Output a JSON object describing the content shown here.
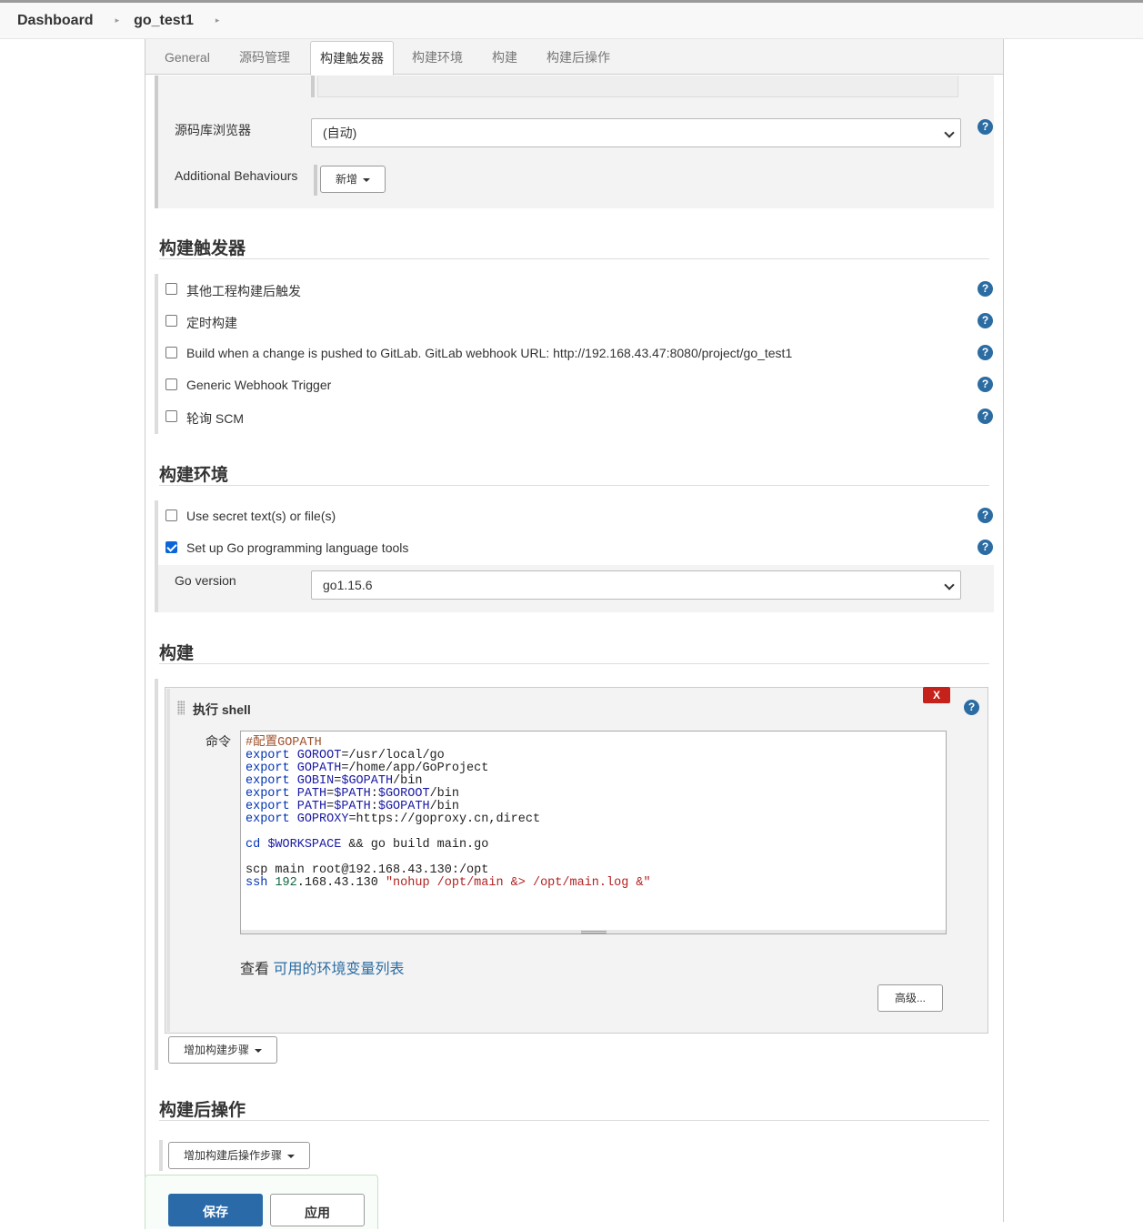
{
  "breadcrumbs": {
    "home": "Dashboard",
    "project": "go_test1"
  },
  "tabs": [
    {
      "label": "General"
    },
    {
      "label": "源码管理"
    },
    {
      "label": "构建触发器"
    },
    {
      "label": "构建环境"
    },
    {
      "label": "构建"
    },
    {
      "label": "构建后操作"
    }
  ],
  "scm": {
    "repo_browser_label": "源码库浏览器",
    "repo_browser_value": "(自动)",
    "additional_behaviours_label": "Additional Behaviours",
    "add_button": "新增"
  },
  "triggers": {
    "title": "构建触发器",
    "items": [
      {
        "label": "其他工程构建后触发",
        "checked": false
      },
      {
        "label": "定时构建",
        "checked": false
      },
      {
        "label": "Build when a change is pushed to GitLab. GitLab webhook URL: http://192.168.43.47:8080/project/go_test1",
        "checked": false
      },
      {
        "label": "Generic Webhook Trigger",
        "checked": false
      },
      {
        "label": "轮询 SCM",
        "checked": false
      }
    ]
  },
  "build_env": {
    "title": "构建环境",
    "items": [
      {
        "label": "Use secret text(s) or file(s)",
        "checked": false
      },
      {
        "label": "Set up Go programming language tools",
        "checked": true
      }
    ],
    "go_version_label": "Go version",
    "go_version_value": "go1.15.6"
  },
  "build": {
    "title": "构建",
    "step_title": "执行 shell",
    "delete_label": "X",
    "command_label": "命令",
    "command_lines": [
      "#配置GOPATH",
      "export GOROOT=/usr/local/go",
      "export GOPATH=/home/app/GoProject",
      "export GOBIN=$GOPATH/bin",
      "export PATH=$PATH:$GOROOT/bin",
      "export PATH=$PATH:$GOPATH/bin",
      "export GOPROXY=https://goproxy.cn,direct",
      "",
      "cd $WORKSPACE && go build main.go",
      "",
      "scp main root@192.168.43.130:/opt",
      "ssh 192.168.43.130 \"nohup /opt/main &> /opt/main.log &\""
    ],
    "env_vars_prefix": "查看",
    "env_vars_link": "可用的环境变量列表",
    "advanced_button": "高级...",
    "add_step_button": "增加构建步骤"
  },
  "post_build": {
    "title": "构建后操作",
    "add_step_button": "增加构建后操作步骤"
  },
  "actions": {
    "save": "保存",
    "apply": "应用"
  },
  "help_icon_text": "?"
}
